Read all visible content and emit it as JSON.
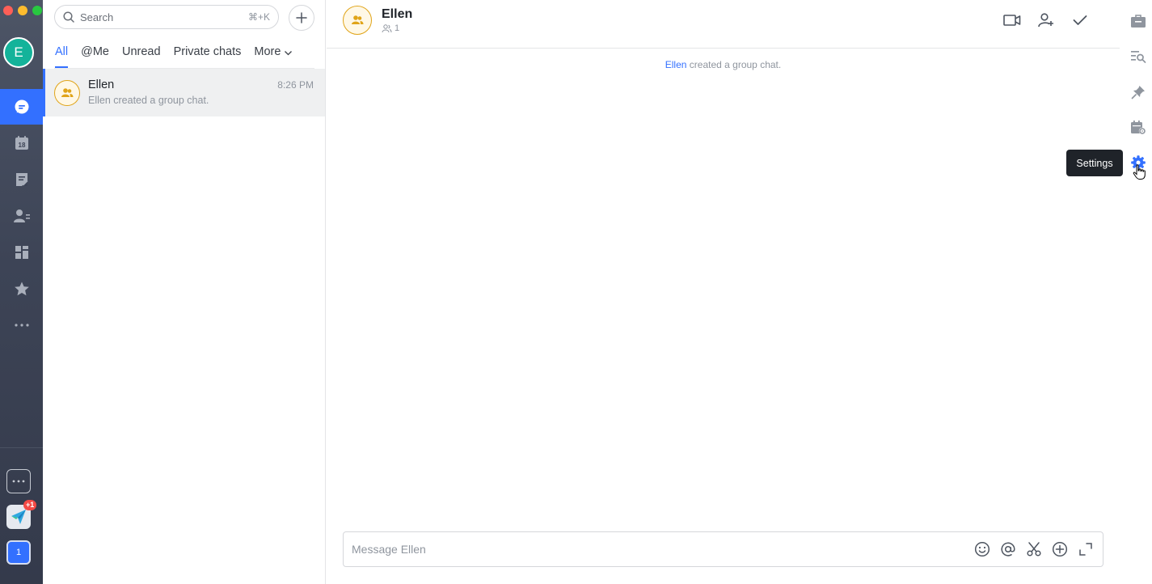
{
  "app": {
    "user_initial": "E",
    "workspace_label": "1",
    "app_badge": "+1"
  },
  "sidebar": {
    "items": [
      {
        "icon": "messenger-icon",
        "active": true
      },
      {
        "icon": "calendar-icon",
        "text": "18"
      },
      {
        "icon": "docs-icon"
      },
      {
        "icon": "contacts-icon"
      },
      {
        "icon": "workplace-icon"
      },
      {
        "icon": "favorites-icon"
      },
      {
        "icon": "more-dots-icon"
      }
    ]
  },
  "chat_list": {
    "search": {
      "placeholder": "Search",
      "shortcut": "⌘+K"
    },
    "tabs": [
      {
        "label": "All",
        "active": true
      },
      {
        "label": "@Me"
      },
      {
        "label": "Unread"
      },
      {
        "label": "Private chats"
      },
      {
        "label": "More"
      }
    ],
    "items": [
      {
        "name": "Ellen",
        "preview": "Ellen created a group chat.",
        "time": "8:26 PM",
        "selected": true
      }
    ]
  },
  "chat": {
    "title": "Ellen",
    "member_count": "1",
    "system_message": {
      "actor": "Ellen",
      "text": "created a group chat."
    },
    "composer": {
      "placeholder": "Message Ellen"
    }
  },
  "right_toolbar": {
    "items": [
      "briefcase-icon",
      "search-history-icon",
      "pin-icon",
      "calendar-settings-icon",
      "settings-icon"
    ],
    "tooltip": "Settings"
  },
  "colors": {
    "accent": "#3370ff",
    "group_avatar": "#e0a418",
    "rail": "#3d4456"
  }
}
